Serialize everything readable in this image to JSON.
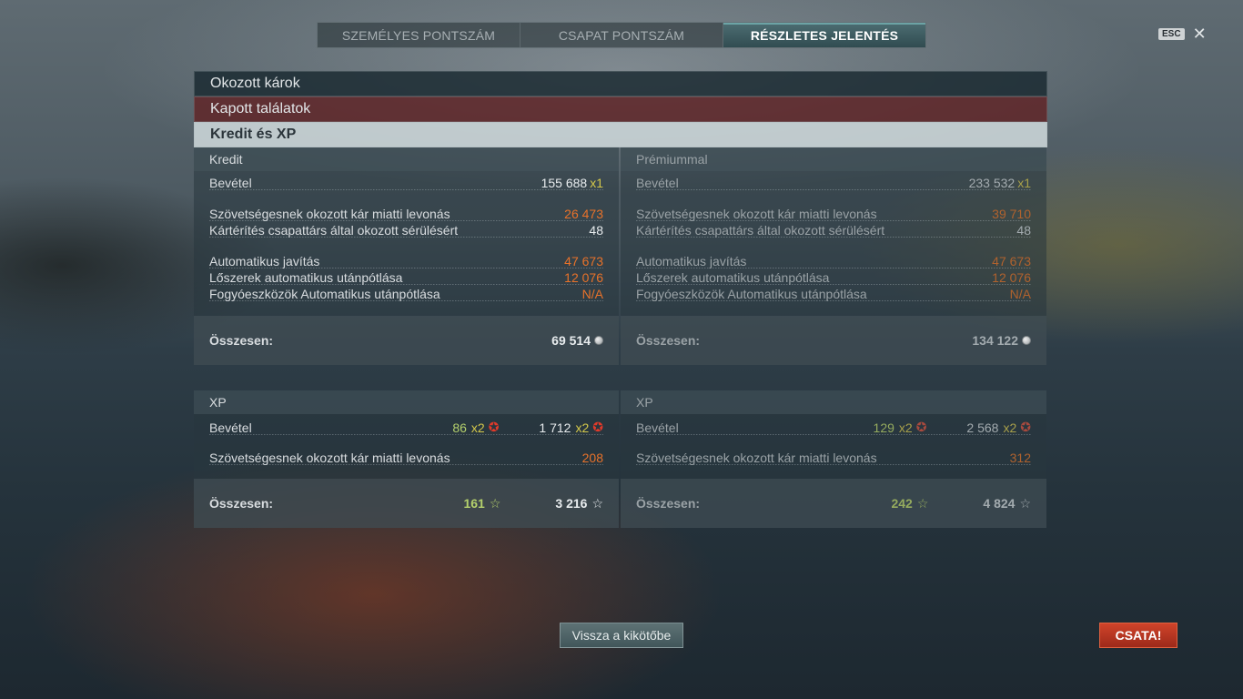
{
  "tabs": [
    {
      "label": "SZEMÉLYES PONTSZÁM",
      "active": false
    },
    {
      "label": "CSAPAT PONTSZÁM",
      "active": false
    },
    {
      "label": "RÉSZLETES JELENTÉS",
      "active": true
    }
  ],
  "close": {
    "key_label": "ESC",
    "icon": "close-icon"
  },
  "sections": {
    "damage_dealt": "Okozott károk",
    "hits_received": "Kapott találatok",
    "credits_xp": "Kredit és XP"
  },
  "credit": {
    "base": {
      "header": "Kredit",
      "income_label": "Bevétel",
      "income_value": "155 688",
      "income_mult": "x1",
      "ally_damage_label": "Szövetségesnek okozott kár miatti levonás",
      "ally_damage_value": "26 473",
      "compensation_label": "Kártérítés csapattárs által okozott sérülésért",
      "compensation_value": "48",
      "auto_repair_label": "Automatikus javítás",
      "auto_repair_value": "47 673",
      "ammo_label": "Lőszerek automatikus utánpótlása",
      "ammo_value": "12 076",
      "consumables_label": "Fogyóeszközök Automatikus utánpótlása",
      "consumables_value": "N/A",
      "total_label": "Összesen:",
      "total_value": "69 514"
    },
    "premium": {
      "header": "Prémiummal",
      "income_label": "Bevétel",
      "income_value": "233 532",
      "income_mult": "x1",
      "ally_damage_label": "Szövetségesnek okozott kár miatti levonás",
      "ally_damage_value": "39 710",
      "compensation_label": "Kártérítés csapattárs által okozott sérülésért",
      "compensation_value": "48",
      "auto_repair_label": "Automatikus javítás",
      "auto_repair_value": "47 673",
      "ammo_label": "Lőszerek automatikus utánpótlása",
      "ammo_value": "12 076",
      "consumables_label": "Fogyóeszközök Automatikus utánpótlása",
      "consumables_value": "N/A",
      "total_label": "Összesen:",
      "total_value": "134 122"
    }
  },
  "xp": {
    "base": {
      "header": "XP",
      "income_label": "Bevétel",
      "income_commander": "86",
      "income_commander_mult": "x2",
      "income_ship": "1 712",
      "income_ship_mult": "x2",
      "ally_damage_label": "Szövetségesnek okozott kár miatti levonás",
      "ally_damage_value": "208",
      "total_label": "Összesen:",
      "total_commander": "161",
      "total_ship": "3 216"
    },
    "premium": {
      "header": "XP",
      "income_label": "Bevétel",
      "income_commander": "129",
      "income_commander_mult": "x2",
      "income_ship": "2 568",
      "income_ship_mult": "x2",
      "ally_damage_label": "Szövetségesnek okozott kár miatti levonás",
      "ally_damage_value": "312",
      "total_label": "Összesen:",
      "total_commander": "242",
      "total_ship": "4 824"
    }
  },
  "buttons": {
    "back_to_port": "Vissza a kikötőbe",
    "battle": "CSATA!"
  },
  "colors": {
    "accent_teal": "#4f7a7e",
    "deduction_orange": "#e8722a",
    "multiplier_yellow": "#d4c84a",
    "battle_red": "#c03a22"
  }
}
